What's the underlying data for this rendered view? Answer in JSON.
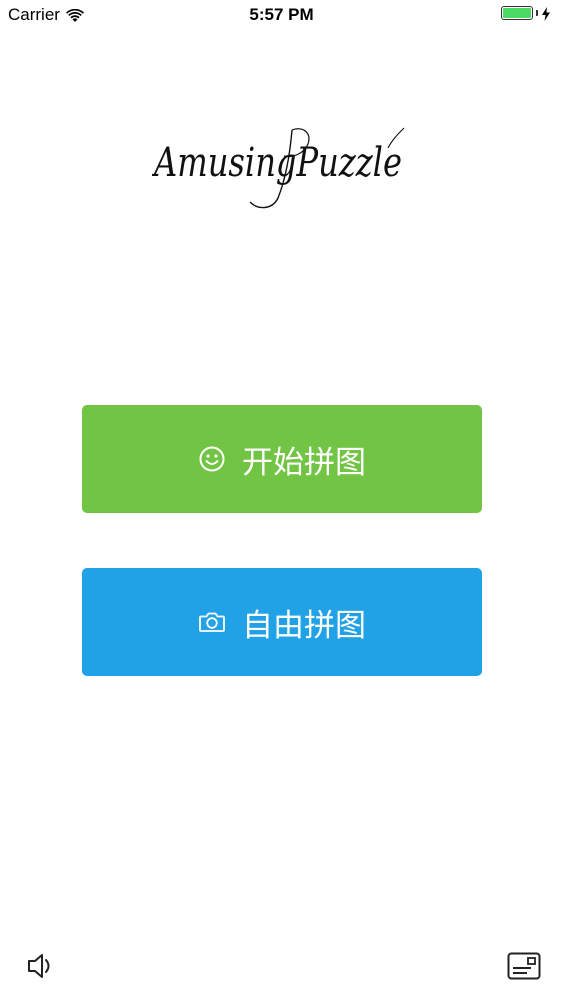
{
  "status_bar": {
    "carrier": "Carrier",
    "time": "5:57 PM",
    "wifi_icon": "wifi-icon",
    "battery_icon": "battery-icon",
    "charging_icon": "bolt-icon"
  },
  "logo": {
    "text": "AmusingPuzzle"
  },
  "buttons": {
    "start": {
      "label": "开始拼图",
      "icon": "smiley-icon",
      "color": "#72c544"
    },
    "free": {
      "label": "自由拼图",
      "icon": "camera-icon",
      "color": "#21a1e6"
    }
  },
  "toolbar": {
    "sound_icon": "speaker-icon",
    "card_icon": "card-icon"
  }
}
